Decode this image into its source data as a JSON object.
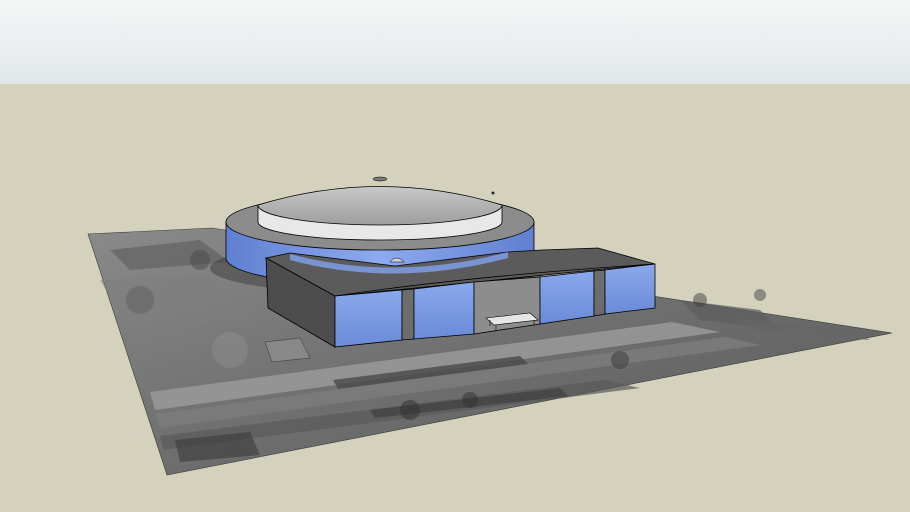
{
  "scene": {
    "colors": {
      "sky_top": "#f4f6f6",
      "sky_bottom": "#e2e8e8",
      "ground": "#d4d2bd",
      "terrain_base": "#6b6b6b",
      "glass_blue": "#7f9fe6",
      "glass_blue_dark": "#5b7ccb",
      "wall_dark": "#5a5a5a",
      "wall_mid": "#8e8e8e",
      "roof_gray": "#b9b9b9",
      "roof_light": "#e4e4e4",
      "edge": "#000000"
    },
    "objects": [
      "terrain-photo",
      "arena-dome",
      "entrance-building"
    ]
  }
}
